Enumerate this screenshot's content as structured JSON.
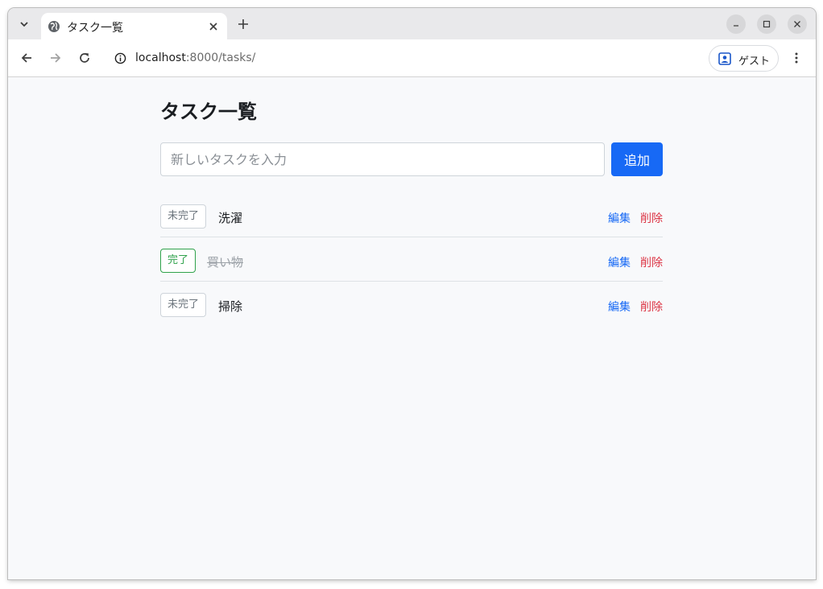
{
  "browser": {
    "tab": {
      "title": "タスク一覧"
    },
    "url": {
      "host": "localhost",
      "path": ":8000/tasks/"
    },
    "profile_label": "ゲスト"
  },
  "page": {
    "title": "タスク一覧",
    "input": {
      "placeholder": "新しいタスクを入力",
      "value": ""
    },
    "add_label": "追加",
    "tasks": [
      {
        "status": "未完了",
        "name": "洗濯",
        "done": false,
        "edit": "編集",
        "delete": "削除"
      },
      {
        "status": "完了",
        "name": "買い物",
        "done": true,
        "edit": "編集",
        "delete": "削除"
      },
      {
        "status": "未完了",
        "name": "掃除",
        "done": false,
        "edit": "編集",
        "delete": "削除"
      }
    ]
  },
  "colors": {
    "accent": "#1769f5",
    "danger": "#dc3545",
    "success": "#2fa24b"
  },
  "icons": [
    "chevron-down-icon",
    "globe-icon",
    "close-icon",
    "plus-icon",
    "minimize-icon",
    "maximize-icon",
    "back-arrow-icon",
    "forward-arrow-icon",
    "reload-icon",
    "info-icon",
    "profile-icon",
    "more-vert-icon"
  ]
}
